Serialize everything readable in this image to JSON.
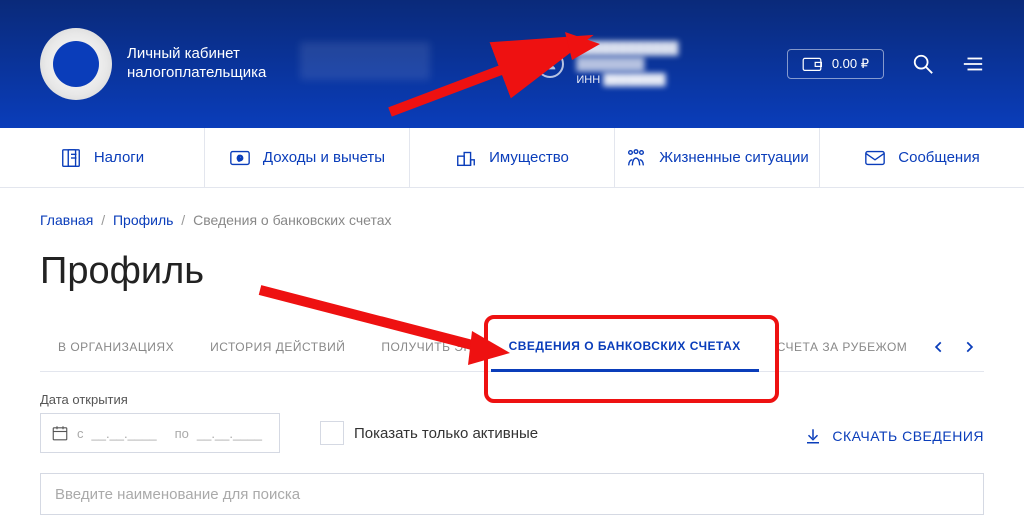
{
  "header": {
    "logo_line1": "Личный кабинет",
    "logo_line2": "налогоплательщика",
    "inn_label": "ИНН",
    "balance": "0.00 ₽"
  },
  "nav": {
    "taxes": "Налоги",
    "income": "Доходы и вычеты",
    "property": "Имущество",
    "situations": "Жизненные ситуации",
    "messages": "Сообщения"
  },
  "breadcrumb": {
    "home": "Главная",
    "profile": "Профиль",
    "current": "Сведения о банковских счетах"
  },
  "page_title": "Профиль",
  "tabs": {
    "orgs": "В ОРГАНИЗАЦИЯХ",
    "history": "ИСТОРИЯ ДЕЙСТВИЙ",
    "get_ep": "ПОЛУЧИТЬ ЭП",
    "bank": "СВЕДЕНИЯ О БАНКОВСКИХ СЧЕТАХ",
    "abroad": "СЧЕТА ЗА РУБЕЖОМ"
  },
  "form": {
    "date_label": "Дата открытия",
    "date_from_prefix": "с",
    "date_from": "__.__.____",
    "date_to_prefix": "по",
    "date_to": "__.__.____",
    "show_active": "Показать только активные",
    "download": "СКАЧАТЬ СВЕДЕНИЯ",
    "search_placeholder": "Введите наименование для поиска"
  }
}
